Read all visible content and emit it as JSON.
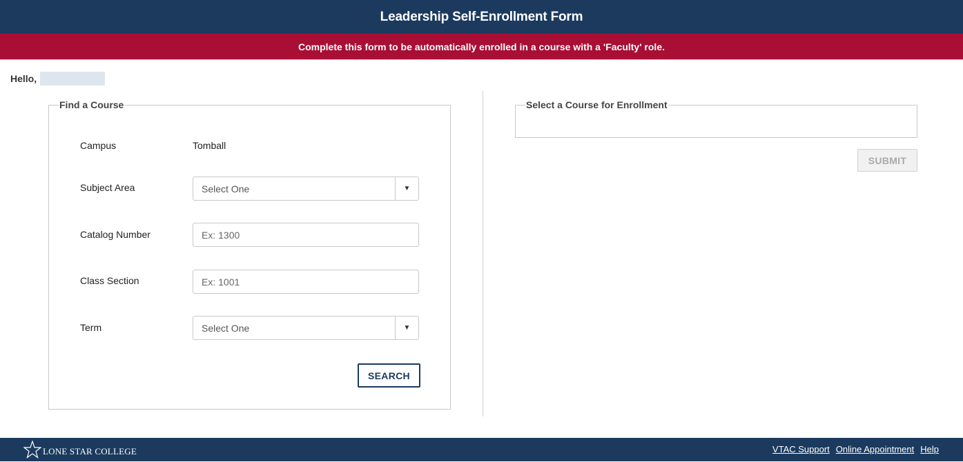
{
  "header": {
    "title": "Leadership Self-Enrollment Form"
  },
  "banner": {
    "text": "Complete this form to be automatically enrolled in a course with a 'Faculty' role."
  },
  "greeting": {
    "label": "Hello,"
  },
  "find_course": {
    "legend": "Find a Course",
    "campus": {
      "label": "Campus",
      "value": "Tomball"
    },
    "subject_area": {
      "label": "Subject Area",
      "selected": "Select One"
    },
    "catalog_number": {
      "label": "Catalog Number",
      "value": "",
      "placeholder": "Ex: 1300"
    },
    "class_section": {
      "label": "Class Section",
      "value": "",
      "placeholder": "Ex: 1001"
    },
    "term": {
      "label": "Term",
      "selected": "Select One"
    },
    "search_label": "SEARCH"
  },
  "enrollment": {
    "legend": "Select a Course for Enrollment",
    "submit_label": "SUBMIT"
  },
  "footer": {
    "logo_text": "LONE STAR COLLEGE",
    "links": [
      "VTAC Support",
      "Online Appointment",
      "Help"
    ]
  },
  "colors": {
    "navy": "#1b3a5e",
    "crimson": "#a90e35"
  },
  "icons": {
    "dropdown": "caret-down-icon",
    "logo": "star-icon"
  }
}
